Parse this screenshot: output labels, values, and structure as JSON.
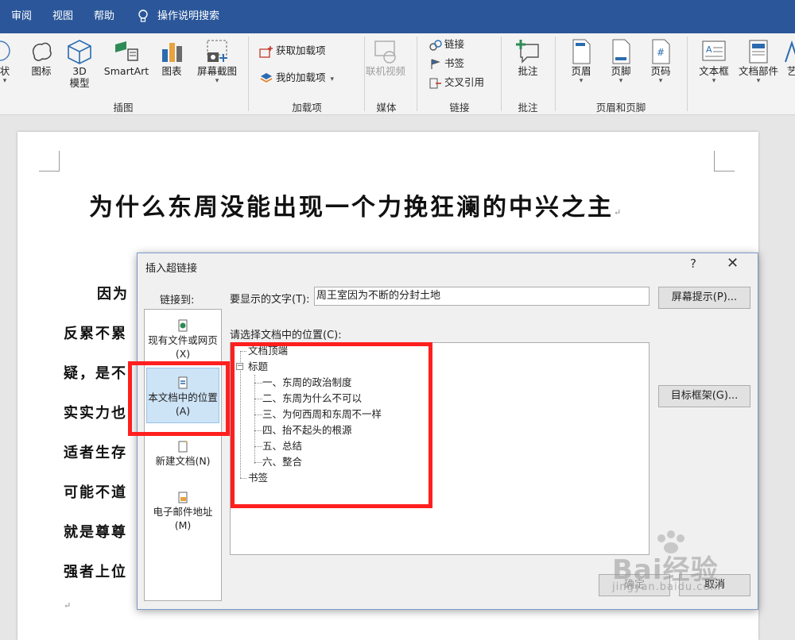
{
  "tabs": [
    "审阅",
    "视图",
    "帮助"
  ],
  "tell_me": "操作说明搜索",
  "ribbon": {
    "illustrations": {
      "shapes_partial": "状",
      "icons": "图标",
      "model3d": [
        "3D",
        "模型"
      ],
      "smartart": "SmartArt",
      "chart": "图表",
      "screenshot": "屏幕截图",
      "group": "插图"
    },
    "addins": {
      "get": "获取加载项",
      "mine": "我的加载项",
      "group": "加载项"
    },
    "media": {
      "online_video": "联机视频",
      "group": "媒体"
    },
    "links": {
      "link": "链接",
      "bookmark": "书签",
      "crossref": "交叉引用",
      "group": "链接"
    },
    "comments": {
      "comment": "批注",
      "group": "批注"
    },
    "header_footer": {
      "header": "页眉",
      "footer": "页脚",
      "page_number": "页码",
      "group": "页眉和页脚"
    },
    "text": {
      "textbox": "文本框",
      "docparts": "文档部件",
      "art_partial": "艺"
    }
  },
  "document": {
    "title": "为什么东周没能出现一个力挽狂澜的中兴之主",
    "lines": [
      "因为",
      "反累不累",
      "疑，是不",
      "实实力也",
      "适者生存",
      "可能不道",
      "就是尊尊",
      "强者上位"
    ]
  },
  "dialog": {
    "title": "插入超链接",
    "help": "?",
    "close": "✕",
    "link_to_label": "链接到:",
    "link_to_items": [
      "现有文件或网页(X)",
      "本文档中的位置(A)",
      "新建文档(N)",
      "电子邮件地址(M)"
    ],
    "display_text_label": "要显示的文字(T):",
    "display_text_value": "周王室因为不断的分封土地",
    "screen_tip_button": "屏幕提示(P)...",
    "select_place_label": "请选择文档中的位置(C):",
    "tree": {
      "top": "文档顶端",
      "headings": "标题",
      "heading_items": [
        "一、东周的政治制度",
        "二、东周为什么不可以",
        "三、为何西周和东周不一样",
        "四、抬不起头的根源",
        "五、总结",
        "六、整合"
      ],
      "bookmarks": "书签"
    },
    "target_frame_button": "目标框架(G)...",
    "ok_button": "确定",
    "cancel_button": "取消"
  },
  "colors": {
    "titlebar": "#2b579a",
    "annotation": "#ff1f1f",
    "selection": "#cde3f6"
  },
  "watermark": {
    "main": "Bai经验",
    "sub": "jingyan.baidu.com"
  }
}
